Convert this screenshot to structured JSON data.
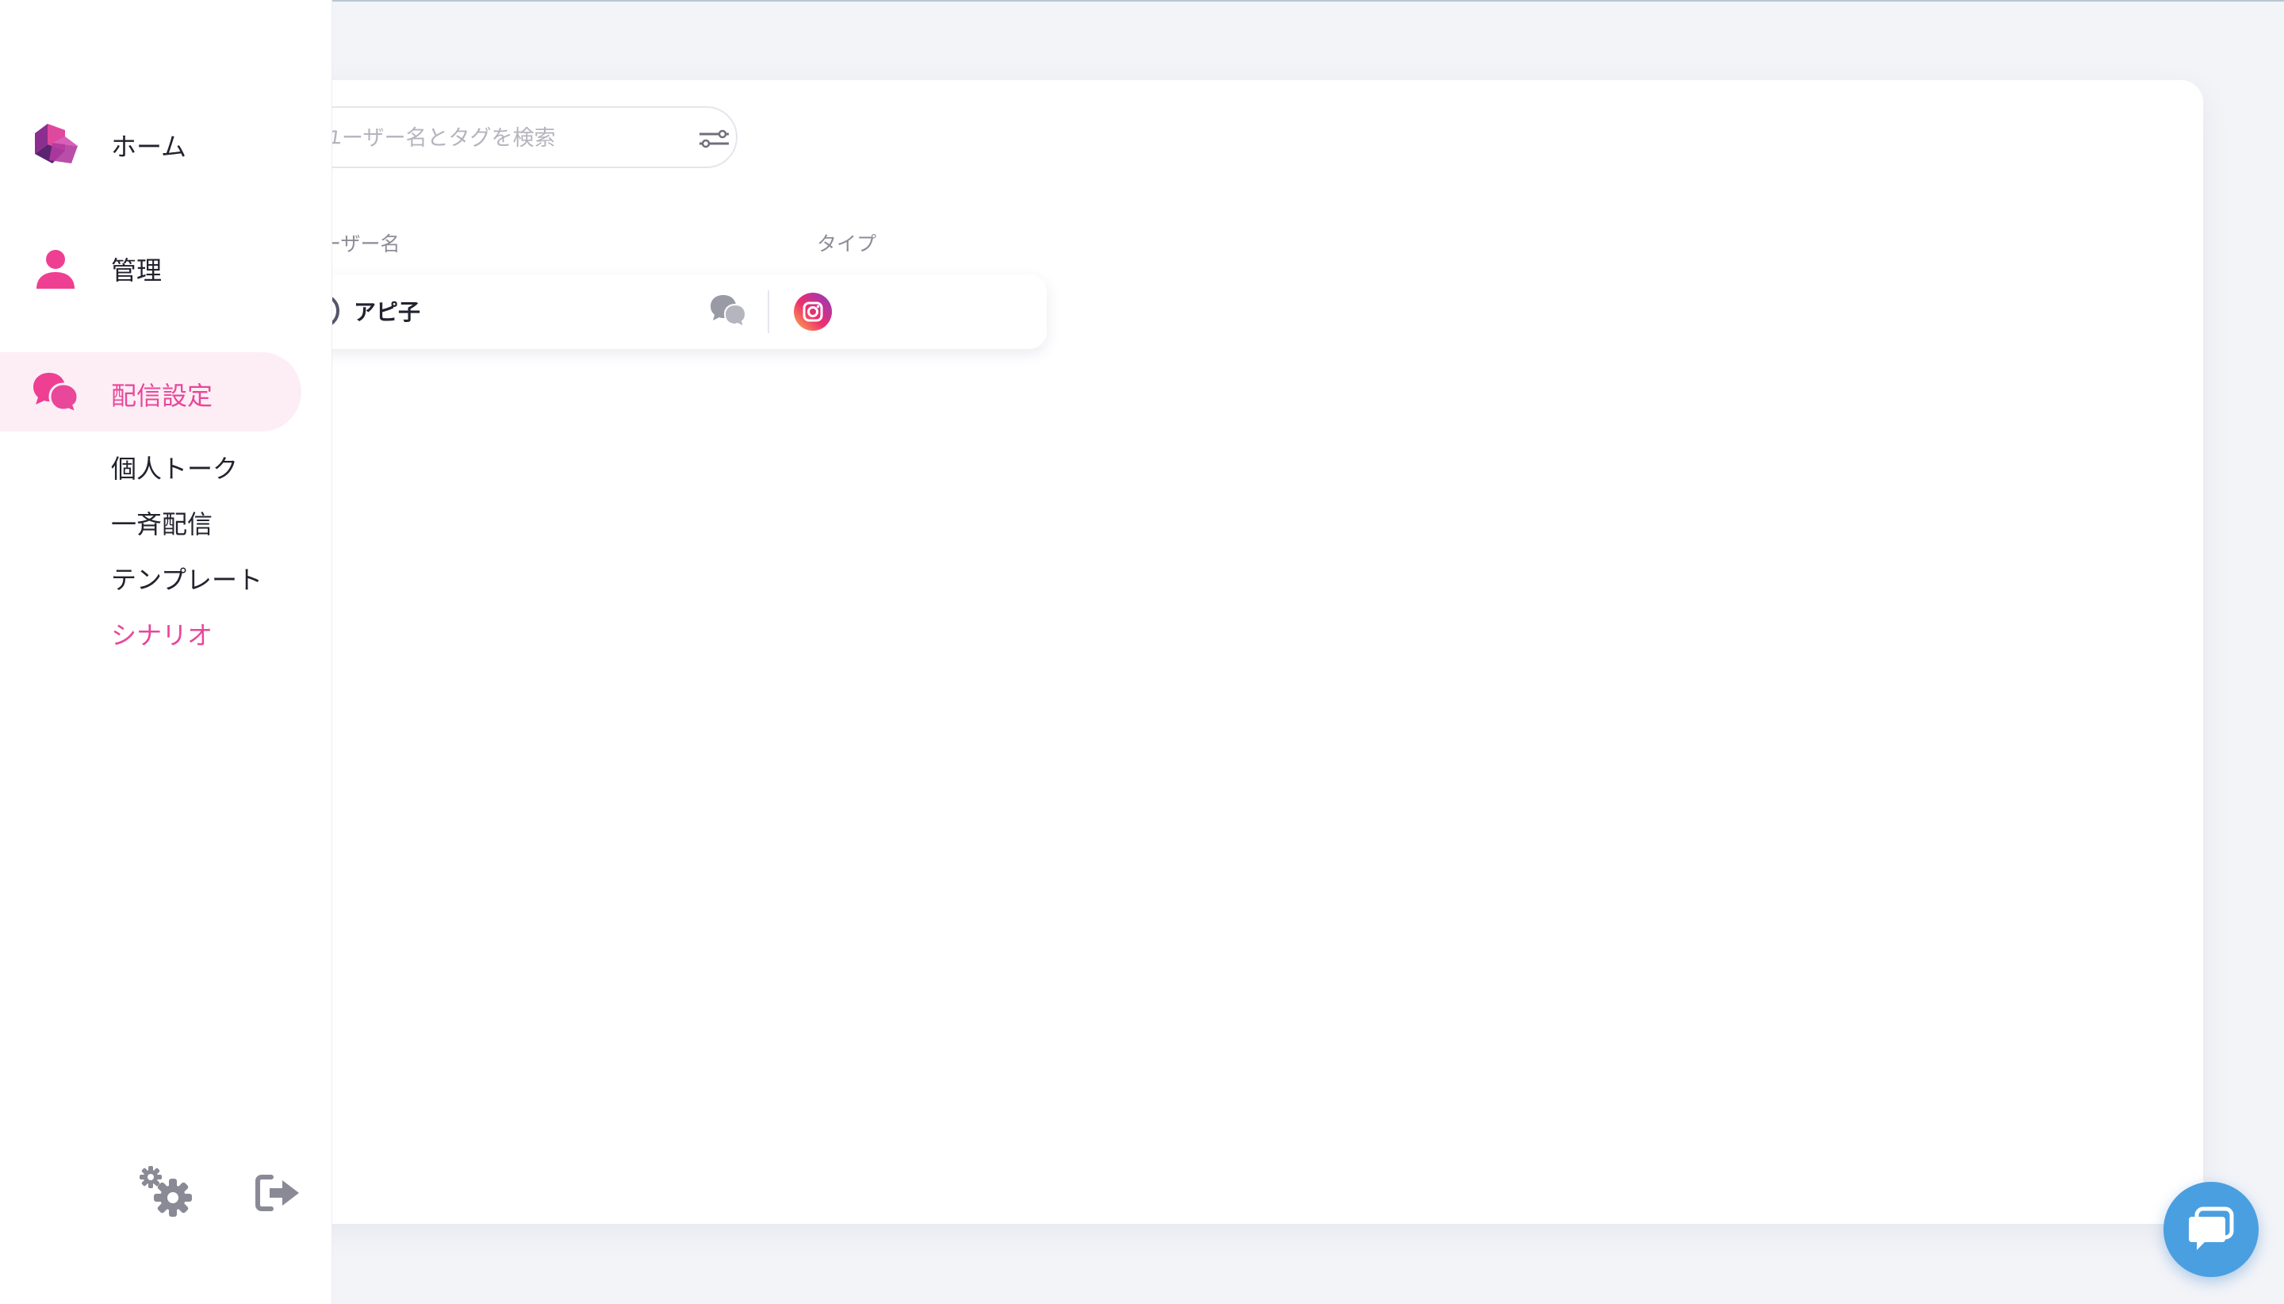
{
  "sidebar": {
    "nav": [
      {
        "label": "ホーム",
        "icon": "logo-cube-icon"
      },
      {
        "label": "管理",
        "icon": "user-icon"
      },
      {
        "label": "配信設定",
        "icon": "chat-bubbles-icon",
        "active": true
      }
    ],
    "sub_items": [
      {
        "label": "個人トーク"
      },
      {
        "label": "一斉配信"
      },
      {
        "label": "テンプレート"
      },
      {
        "label": "シナリオ",
        "active": true
      }
    ],
    "bottom": {
      "settings_icon": "gears-icon",
      "logout_icon": "logout-icon"
    }
  },
  "search": {
    "placeholder": "ユーザー名とタグを検索",
    "filter_icon": "filter-sliders-icon"
  },
  "table": {
    "columns": [
      "ユーザー名",
      "タイプ"
    ],
    "rows": [
      {
        "name": "アピ子",
        "chat_icon": "chat-bubbles-icon",
        "type_icon": "instagram-icon"
      }
    ]
  },
  "support": {
    "icon": "chat-support-icon"
  },
  "colors": {
    "accent": "#e8479a",
    "active_bg": "#fdeef5",
    "support_button": "#4a9fe0"
  }
}
